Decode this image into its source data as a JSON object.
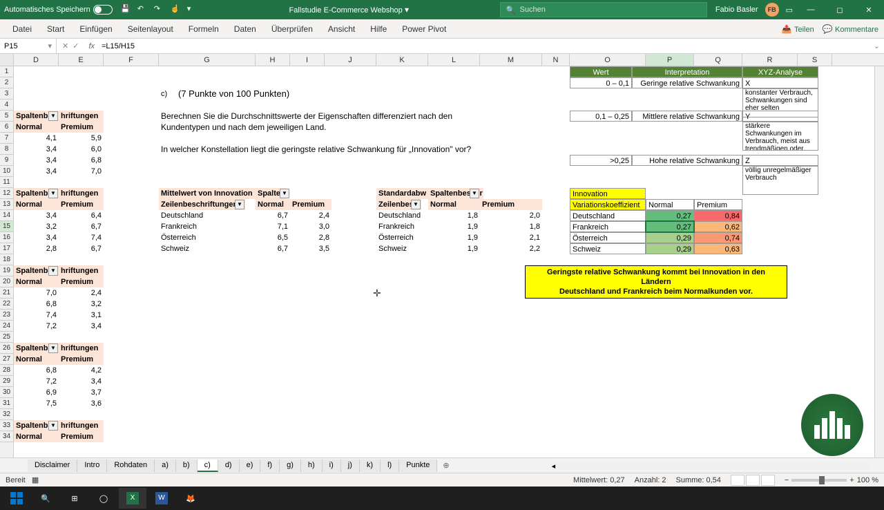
{
  "titlebar": {
    "autosave": "Automatisches Speichern",
    "doc": "Fallstudie E-Commerce Webshop",
    "search": "Suchen",
    "user": "Fabio Basler",
    "initials": "FB"
  },
  "ribbon": {
    "tabs": [
      "Datei",
      "Start",
      "Einfügen",
      "Seitenlayout",
      "Formeln",
      "Daten",
      "Überprüfen",
      "Ansicht",
      "Hilfe",
      "Power Pivot"
    ],
    "share": "Teilen",
    "comments": "Kommentare"
  },
  "formula": {
    "name": "P15",
    "value": "=L15/H15"
  },
  "cols": [
    {
      "l": "D",
      "w": 65
    },
    {
      "l": "E",
      "w": 65
    },
    {
      "l": "F",
      "w": 80
    },
    {
      "l": "G",
      "w": 140
    },
    {
      "l": "H",
      "w": 50
    },
    {
      "l": "I",
      "w": 50
    },
    {
      "l": "J",
      "w": 75
    },
    {
      "l": "K",
      "w": 75
    },
    {
      "l": "L",
      "w": 75
    },
    {
      "l": "M",
      "w": 90
    },
    {
      "l": "N",
      "w": 40
    },
    {
      "l": "O",
      "w": 110
    },
    {
      "l": "P",
      "w": 70
    },
    {
      "l": "Q",
      "w": 70
    },
    {
      "l": "R",
      "w": 80
    },
    {
      "l": "S",
      "w": 50
    }
  ],
  "question": {
    "label": "c)",
    "pts": "(7 Punkte von 100 Punkten)",
    "l1": "Berechnen  Sie  die  Durchschnittswerte  der  Eigenschaften  differenziert  nach  den",
    "l2": "Kundentypen und nach dem jeweiligen Land.",
    "l3": "In  welcher  Konstellation  liegt  die  geringste  relative  Schwankung  für  „Innovation\"  vor?"
  },
  "pivot": {
    "colhdr": "Spaltenbe",
    "colhdr2": "hriftungen",
    "normal": "Normal",
    "premium": "Premium",
    "b1": [
      [
        "4,1",
        "5,9"
      ],
      [
        "3,4",
        "6,0"
      ],
      [
        "3,4",
        "6,8"
      ],
      [
        "3,4",
        "7,0"
      ]
    ],
    "b2": [
      [
        "3,4",
        "6,4"
      ],
      [
        "3,2",
        "6,7"
      ],
      [
        "3,4",
        "7,4"
      ],
      [
        "2,8",
        "6,7"
      ]
    ],
    "b3": [
      [
        "7,0",
        "2,4"
      ],
      [
        "6,8",
        "3,2"
      ],
      [
        "7,4",
        "3,1"
      ],
      [
        "7,2",
        "3,4"
      ]
    ],
    "b4": [
      [
        "6,8",
        "4,2"
      ],
      [
        "7,2",
        "3,4"
      ],
      [
        "6,9",
        "3,7"
      ],
      [
        "7,5",
        "3,6"
      ]
    ]
  },
  "mittelwert": {
    "title": "Mittelwert von Innovation",
    "sp": "Spalter",
    "zeilen": "Zeilenbeschriftungen",
    "normal": "Normal",
    "premium": "Premium",
    "rows": [
      [
        "Deutschland",
        "6,7",
        "2,4"
      ],
      [
        "Frankreich",
        "7,1",
        "3,0"
      ],
      [
        "Österreich",
        "6,5",
        "2,8"
      ],
      [
        "Schweiz",
        "6,7",
        "3,5"
      ]
    ]
  },
  "stdabw": {
    "title": "Standardabw",
    "sp": "Spaltenbeschr",
    "zeilen": "Zeilenbesc",
    "normal": "Normal",
    "premium": "Premium",
    "rows": [
      [
        "Deutschland",
        "1,8",
        "2,0"
      ],
      [
        "Frankreich",
        "1,9",
        "1,8"
      ],
      [
        "Österreich",
        "1,9",
        "2,1"
      ],
      [
        "Schweiz",
        "1,9",
        "2,2"
      ]
    ]
  },
  "innov": {
    "title": "Innovation",
    "vk": "Variationskoeffizient",
    "normal": "Normal",
    "premium": "Premium",
    "rows": [
      [
        "Deutschland",
        "0,27",
        "0,84"
      ],
      [
        "Frankreich",
        "0,27",
        "0,62"
      ],
      [
        "Österreich",
        "0,29",
        "0,74"
      ],
      [
        "Schweiz",
        "0,29",
        "0,63"
      ]
    ]
  },
  "interp": {
    "h": [
      "Wert",
      "Interpretation",
      "XYZ-Analyse"
    ],
    "r": [
      [
        "0 – 0,1",
        "Geringe relative Schwankung",
        "X",
        "konstanter Verbrauch, Schwankungen sind eher selten"
      ],
      [
        "0,1 – 0,25",
        "Mittlere relative Schwankung",
        "Y",
        "stärkere Schwankungen im Verbrauch, meist aus trendmäßigen oder saisonalen Gründen"
      ],
      [
        ">0,25",
        "Hohe relative Schwankung",
        "Z",
        "völlig unregelmäßiger Verbrauch"
      ]
    ]
  },
  "answer": {
    "l1": "Geringste relative Schwankung kommt bei Innovation in den Ländern",
    "l2": "Deutschland und Frankreich beim Normalkunden vor."
  },
  "sheets": [
    "Disclaimer",
    "Intro",
    "Rohdaten",
    "a)",
    "b)",
    "c)",
    "d)",
    "e)",
    "f)",
    "g)",
    "h)",
    "i)",
    "j)",
    "k)",
    "l)",
    "Punkte"
  ],
  "status": {
    "ready": "Bereit",
    "mw": "Mittelwert: 0,27",
    "anz": "Anzahl: 2",
    "sum": "Summe: 0,54",
    "zoom": "100 %"
  }
}
